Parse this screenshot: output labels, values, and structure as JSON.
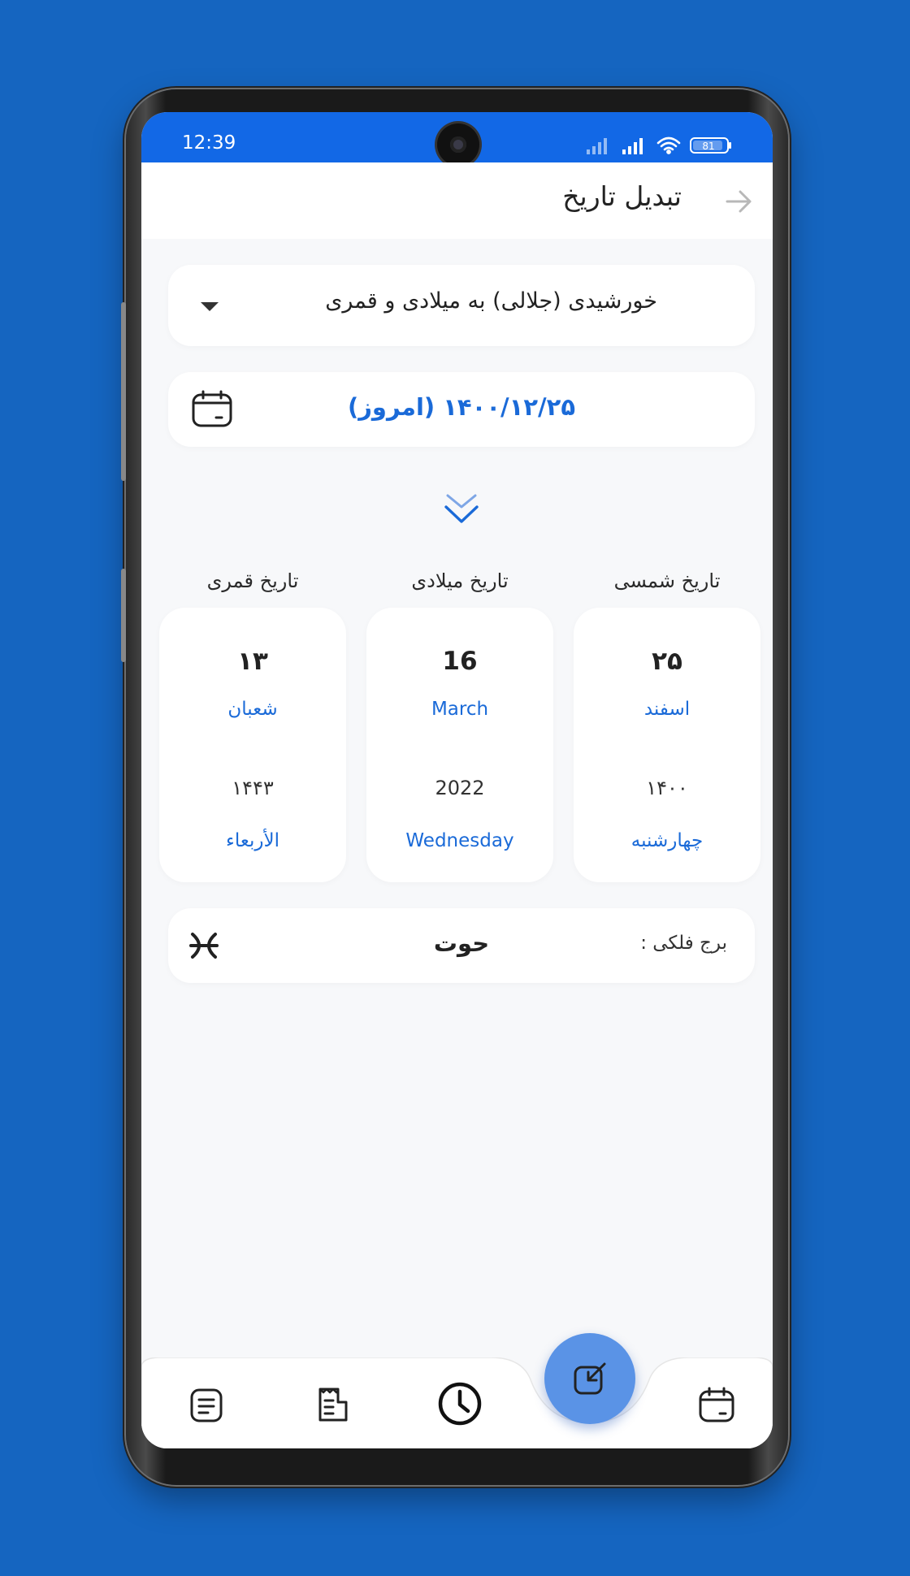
{
  "status_bar": {
    "time": "12:39",
    "battery": "81"
  },
  "header": {
    "title": "تبدیل تاریخ"
  },
  "converter": {
    "mode_label": "خورشیدی (جلالی) به میلادی و قمری"
  },
  "date_input": {
    "value": "۱۴۰۰/۱۲/۲۵ (امروز)"
  },
  "columns": [
    {
      "label": "تاریخ شمسی",
      "day": "۲۵",
      "month": "اسفند",
      "year": "۱۴۰۰",
      "weekday": "چهارشنبه"
    },
    {
      "label": "تاریخ میلادی",
      "day": "16",
      "month": "March",
      "year": "2022",
      "weekday": "Wednesday"
    },
    {
      "label": "تاریخ قمری",
      "day": "۱۳",
      "month": "شعبان",
      "year": "۱۴۴۳",
      "weekday": "الأربعاء"
    }
  ],
  "zodiac": {
    "label": "برج فلکی :",
    "value": "حوت"
  },
  "nav": {
    "items": [
      "notes-icon",
      "receipt-icon",
      "clock-icon",
      "convert-icon",
      "calendar-icon"
    ],
    "active": "convert-icon"
  },
  "colors": {
    "accent": "#1a6ad8",
    "status_bar": "#1268e6",
    "fab": "#5a93e6",
    "background": "#1565c0"
  }
}
